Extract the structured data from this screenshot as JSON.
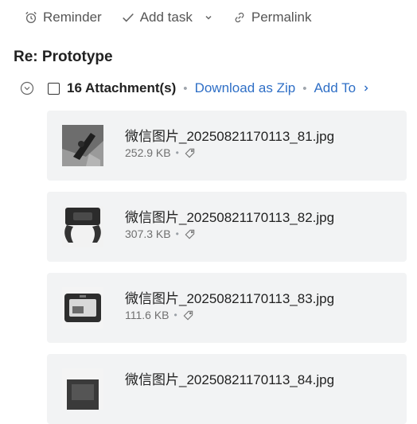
{
  "toolbar": {
    "reminder_label": "Reminder",
    "add_task_label": "Add task",
    "permalink_label": "Permalink"
  },
  "message": {
    "subject": "Re: Prototype"
  },
  "attachments": {
    "count_label": "16 Attachment(s)",
    "download_zip_label": "Download as Zip",
    "add_to_label": "Add To",
    "items": [
      {
        "name": "微信图片_20250821170113_81.jpg",
        "size": "252.9 KB"
      },
      {
        "name": "微信图片_20250821170113_82.jpg",
        "size": "307.3 KB"
      },
      {
        "name": "微信图片_20250821170113_83.jpg",
        "size": "111.6 KB"
      },
      {
        "name": "微信图片_20250821170113_84.jpg",
        "size": ""
      }
    ]
  },
  "colors": {
    "link": "#2f6fc6",
    "card_bg": "#f2f3f4",
    "muted_text": "#707070"
  },
  "icons": [
    "alarm-clock-icon",
    "checkmark-icon",
    "chevron-down-icon",
    "link-icon",
    "collapse-circle-icon",
    "chevron-right-icon",
    "tag-icon"
  ]
}
